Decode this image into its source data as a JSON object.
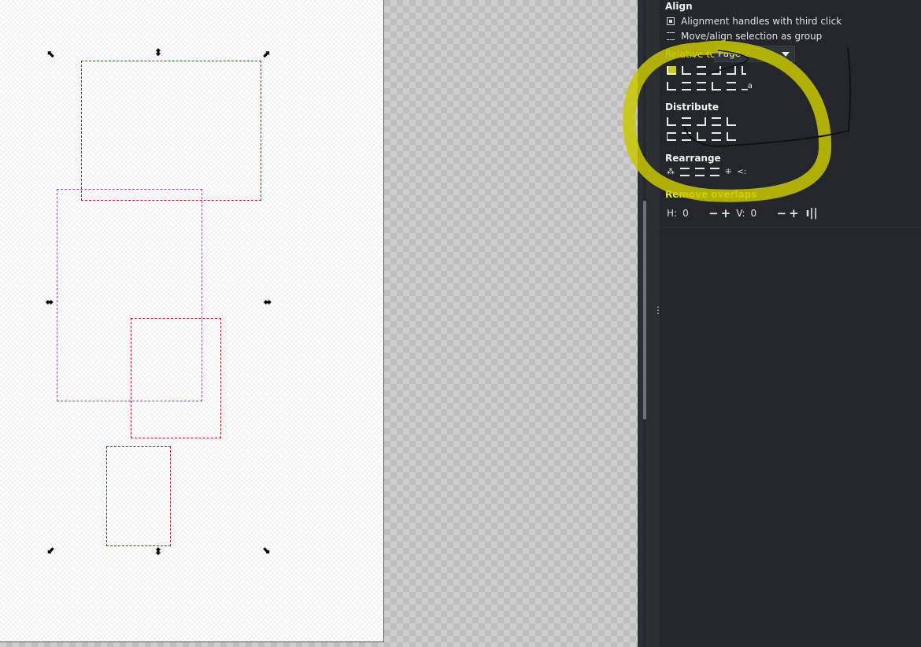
{
  "panel": {
    "align_title": "Align",
    "opt_third_click": "Alignment handles with third click",
    "opt_move_group": "Move/align selection as group",
    "relative_to_label": "Relative to:",
    "relative_to_value": "Page",
    "distribute_title": "Distribute",
    "rearrange_title": "Rearrange",
    "remove_overlaps_title": "Remove overlaps",
    "h_label": "H:",
    "h_value": "0",
    "v_label": "V:",
    "v_value": "0",
    "minus": "−",
    "plus": "+"
  },
  "icons": {
    "align_row1": [
      "align-left-edge-icon",
      "align-left-icon",
      "center-vertical-axis-icon",
      "align-right-icon",
      "align-right-edge-icon",
      "text-align-left-icon"
    ],
    "align_row2": [
      "align-bottom-edge-icon",
      "align-top-icon",
      "center-horizontal-axis-icon",
      "align-bottom-icon",
      "align-top-edge-icon",
      "text-baseline-icon"
    ],
    "distribute_row1": [
      "distribute-left-icon",
      "distribute-center-h-icon",
      "distribute-right-icon",
      "distribute-gaps-h-icon",
      "distribute-text-icon"
    ],
    "distribute_row2": [
      "distribute-top-icon",
      "distribute-center-v-icon",
      "distribute-bottom-icon",
      "distribute-gaps-v-icon",
      "distribute-baseline-icon"
    ],
    "rearrange_row": [
      "graph-layout-icon",
      "exchange-selection-order-icon",
      "exchange-z-order-icon",
      "exchange-clockwise-icon",
      "randomize-icon",
      "unclump-icon"
    ],
    "apply_overlap": "apply-remove-overlaps-icon"
  },
  "handles": {
    "top_left": "⬉",
    "top_center": "⬍",
    "top_right": "⬈",
    "mid_left": "⬌",
    "mid_right": "⬌",
    "bottom_left": "⬋",
    "bottom_center": "⬍",
    "bottom_right": "⬊"
  },
  "colors": {
    "selection_dash": "#b02020",
    "highlight": "#e2e23a",
    "panel_bg": "#23272b"
  }
}
